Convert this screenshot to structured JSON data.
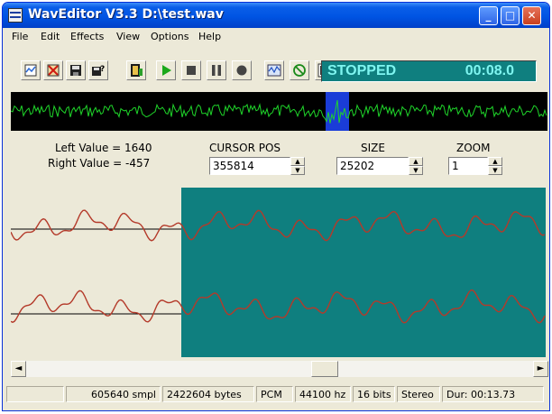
{
  "window": {
    "title": "WavEditor V3.3 D:\\test.wav"
  },
  "title_buttons": {
    "minimize": "_",
    "maximize": "□",
    "close": "✕"
  },
  "menu": [
    "File",
    "Edit",
    "Effects",
    "View",
    "Options",
    "Help"
  ],
  "toolbar": {
    "icons": [
      "new-file-icon",
      "delete-icon",
      "save-icon",
      "save-as-icon",
      "export-icon",
      "play-icon",
      "stop-icon",
      "pause-icon",
      "record-icon",
      "mixer-icon",
      "no-loop-icon",
      "equalizer-icon"
    ],
    "status": "STOPPED",
    "time": "00:08.0"
  },
  "readouts": {
    "left_value": "Left Value = 1640",
    "right_value": "Right Value = -457",
    "cursor_pos_label": "CURSOR POS",
    "cursor_pos": "355814",
    "size_label": "SIZE",
    "size": "25202",
    "zoom_label": "ZOOM",
    "zoom": "1"
  },
  "scroll": {
    "left_arrow": "◄",
    "right_arrow": "►"
  },
  "status": {
    "samples": "605640 smpl",
    "bytes": "2422604 bytes",
    "format": "PCM",
    "rate": "44100 hz",
    "bits": "16 bits",
    "channels": "Stereo",
    "duration": "Dur: 00:13.73"
  },
  "colors": {
    "selection": "#0f7f7f",
    "wave_unselected": "#ece9d8",
    "wave_line": "#b43a2a",
    "overview_wave": "#1fd62a",
    "overview_cursor": "#1a3cd8"
  }
}
